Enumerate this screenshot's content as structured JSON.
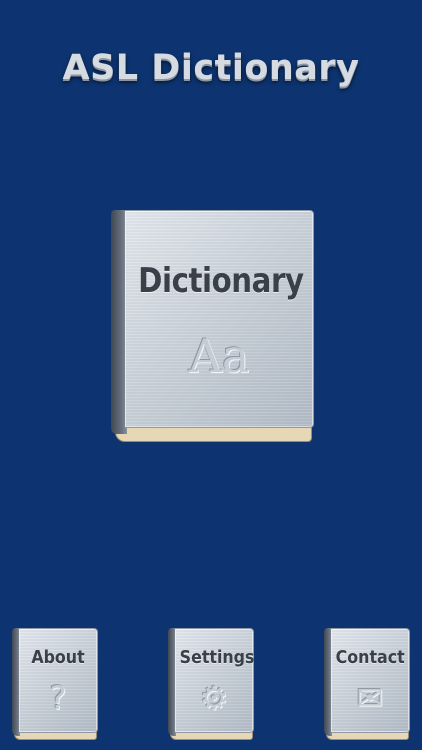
{
  "app": {
    "title": "ASL Dictionary"
  },
  "main_book": {
    "label": "Dictionary",
    "glyph": "Aa",
    "icon": "font-aa-icon"
  },
  "bottom_books": [
    {
      "label": "About",
      "glyph": "?",
      "icon": "question-icon"
    },
    {
      "label": "Settings",
      "glyph": "⚙",
      "icon": "gear-icon"
    },
    {
      "label": "Contact",
      "glyph": "✉",
      "icon": "envelope-icon"
    }
  ],
  "colors": {
    "background": "#0d3470",
    "title": "#d6dbe2",
    "cover": "#cfd6de",
    "pages": "#e7d8b5"
  }
}
